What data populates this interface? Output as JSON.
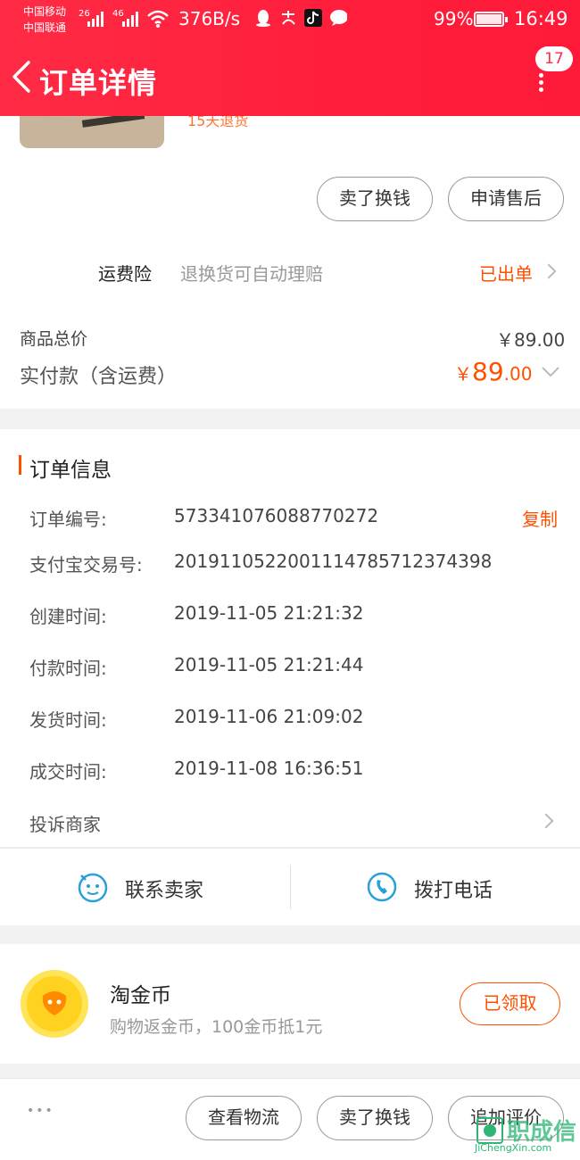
{
  "status_bar": {
    "carrier1": "中国移动",
    "carrier2": "中国联通",
    "sig1": "26",
    "sig2": "46",
    "net_speed": "376B/s",
    "icons": [
      "qq-icon",
      "alipay-icon",
      "tiktok-icon",
      "chat-icon"
    ],
    "battery": "99%",
    "battery_level": 0.99,
    "time": "16:49"
  },
  "header": {
    "title": "订单详情",
    "badge": "17"
  },
  "product": {
    "tag": "15天退货"
  },
  "action_buttons": {
    "sell": "卖了换钱",
    "after_sale": "申请售后"
  },
  "shipping_insurance": {
    "label": "运费险",
    "desc": "退换货可自动理赔",
    "status": "已出单"
  },
  "price": {
    "total_label": "商品总价",
    "total_value": "￥89.00",
    "paid_label": "实付款（含运费）",
    "paid_currency": "￥",
    "paid_int": "89",
    "paid_dec": ".00"
  },
  "order_info": {
    "title": "订单信息",
    "copy": "复制",
    "rows": [
      {
        "label": "订单编号:",
        "value": "573341076088770272"
      },
      {
        "label": "支付宝交易号:",
        "value": "2019110522001114785712374398"
      },
      {
        "label": "创建时间:",
        "value": "2019-11-05 21:21:32"
      },
      {
        "label": "付款时间:",
        "value": "2019-11-05 21:21:44"
      },
      {
        "label": "发货时间:",
        "value": "2019-11-06 21:09:02"
      },
      {
        "label": "成交时间:",
        "value": "2019-11-08 16:36:51"
      }
    ],
    "complain": "投诉商家"
  },
  "contact": {
    "seller": "联系卖家",
    "call": "拨打电话"
  },
  "coins": {
    "title": "淘金币",
    "desc": "购物返金币，100金币抵1元",
    "button": "已领取"
  },
  "bottom_bar": {
    "more": "•••",
    "logistics": "查看物流",
    "sell": "卖了换钱",
    "review": "追加评价"
  },
  "watermark": {
    "cn": "职成信",
    "en": "JiChengXin.com"
  },
  "colors": {
    "header_red": "#ff2b45",
    "accent_orange": "#ff5000",
    "contact_blue": "#2a9fd8"
  }
}
